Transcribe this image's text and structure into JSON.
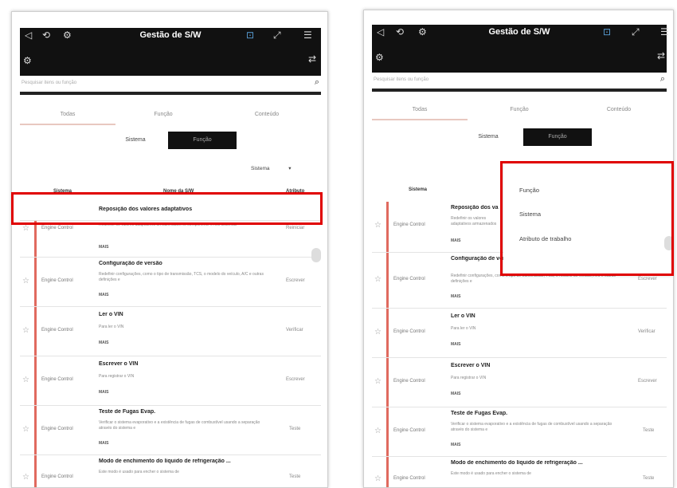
{
  "app": {
    "title": "Gestão de S/W"
  },
  "search": {
    "placeholder": "Pesquisar itens ou função"
  },
  "tabs": [
    "Todas",
    "Função",
    "Conteúdo"
  ],
  "segments": {
    "left": "Sistema",
    "right": "Função"
  },
  "dropdown": {
    "value": "Sistema"
  },
  "table_headers": {
    "system": "Sistema",
    "name": "Nome da S/W",
    "type": "Atributo"
  },
  "left_rows": [
    {
      "title": "Reposição dos valores adaptativos",
      "system": "",
      "desc": "",
      "type": ""
    },
    {
      "title": "",
      "system": "Engine Control",
      "desc": "Redefinir os valores adaptativos armazenados no componente e nos sistemas",
      "type": "Reiniciar"
    },
    {
      "title": "Configuração de versão",
      "system": "Engine Control",
      "desc": "Redefinir configurações, como o tipo de transmissão, TCS, o modelo do veículo, A/C e outras definições e",
      "type": "Escrever"
    },
    {
      "title": "Ler o VIN",
      "system": "Engine Control",
      "desc": "Para ler o VIN",
      "type": "Verificar"
    },
    {
      "title": "Escrever o VIN",
      "system": "Engine Control",
      "desc": "Para registrar o VIN",
      "type": "Escrever"
    },
    {
      "title": "Teste de Fugas Evap.",
      "system": "Engine Control",
      "desc": "Verificar o sistema evaporativo e a existência de fugas de combustível usando a separação através do sistema e",
      "type": "Teste"
    },
    {
      "title": "Modo de enchimento do líquido de refrigeração ...",
      "system": "Engine Control",
      "desc": "Este modo é usado para encher o sistema de",
      "type": "Teste"
    }
  ],
  "right_rows": [
    {
      "title": "Reposição dos va",
      "system": "Engine Control",
      "desc": "Redefinir os valores adaptativos armazenados",
      "type": ""
    },
    {
      "title": "Configuração de versão",
      "system": "Engine Control",
      "desc": "Redefinir configurações, como o tipo de transmissão, TCS, o modelo do veículo, A/C e outras definições e",
      "type": "Escrever"
    },
    {
      "title": "Ler o VIN",
      "system": "Engine Control",
      "desc": "Para ler o VIN",
      "type": "Verificar"
    },
    {
      "title": "Escrever o VIN",
      "system": "Engine Control",
      "desc": "Para registrar o VIN",
      "type": "Escrever"
    },
    {
      "title": "Teste de Fugas Evap.",
      "system": "Engine Control",
      "desc": "Verificar o sistema evaporativo e a existência de fugas de combustível usando a separação através do sistema e",
      "type": "Teste"
    },
    {
      "title": "Modo de enchimento do líquido de refrigeração ...",
      "system": "Engine Control",
      "desc": "Este modo é usado para encher o sistema de",
      "type": "Teste"
    }
  ],
  "more_label": "MAIS",
  "menu_options": [
    "Função",
    "Sistema",
    "Atributo de trabalho"
  ],
  "icons": {
    "back": "◁",
    "history": "⟲",
    "car": "⚙",
    "wifi": "⊡",
    "expand": "⤢",
    "menu": "☰",
    "search": "⌕",
    "star": "☆",
    "swap": "⇄"
  },
  "colors": {
    "accent_red": "#e06a5f",
    "highlight": "#e00000",
    "topbar": "#111111"
  }
}
